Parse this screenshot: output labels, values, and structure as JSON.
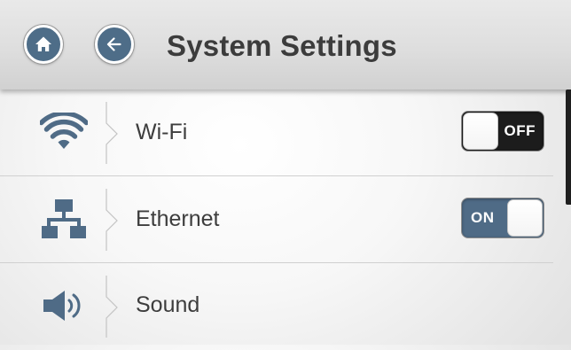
{
  "header": {
    "title": "System Settings",
    "home_icon": "home-icon",
    "back_icon": "arrow-left-circle-icon",
    "button_color": "#4e6d88"
  },
  "settings": {
    "items": [
      {
        "id": "wifi",
        "label": "Wi-Fi",
        "icon": "wifi-icon",
        "toggle": {
          "state": "off",
          "text": "OFF"
        }
      },
      {
        "id": "ethernet",
        "label": "Ethernet",
        "icon": "network-icon",
        "toggle": {
          "state": "on",
          "text": "ON"
        }
      },
      {
        "id": "sound",
        "label": "Sound",
        "icon": "speaker-icon"
      }
    ]
  },
  "colors": {
    "accent": "#4f6b86",
    "toggle_off": "#1c1c1c",
    "icon": "#4f6b86",
    "text": "#3d3d3d"
  }
}
